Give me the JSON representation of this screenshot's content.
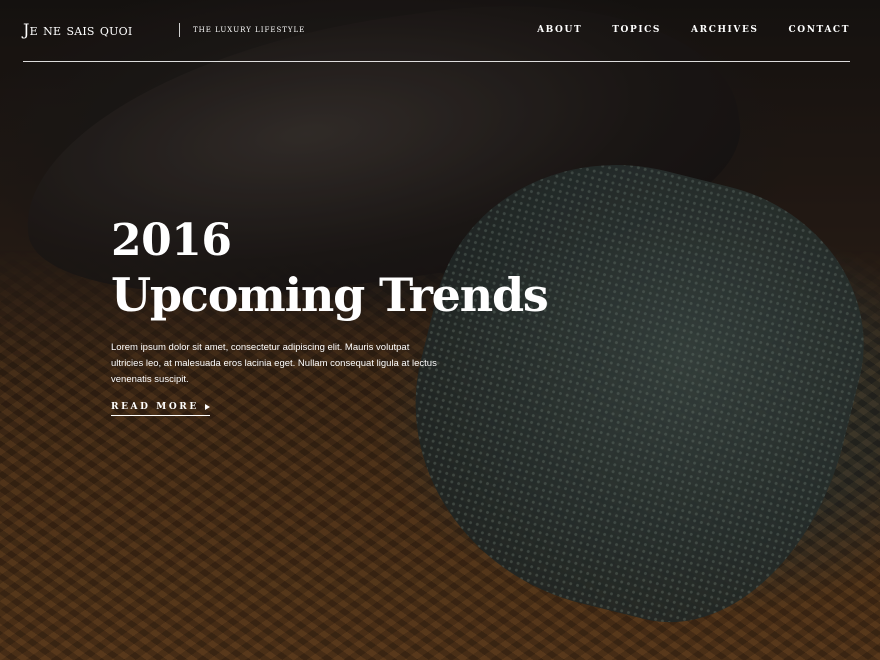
{
  "brand": {
    "logo": "Je ne sais quoi",
    "tagline": "THE LUXURY LIFESTYLE"
  },
  "nav": {
    "items": [
      {
        "label": "ABOUT"
      },
      {
        "label": "TOPICS"
      },
      {
        "label": "ARCHIVES"
      },
      {
        "label": "CONTACT"
      }
    ]
  },
  "hero": {
    "year": "2016",
    "title": "Upcoming Trends",
    "body": "Lorem ipsum dolor sit amet, consectetur adipiscing elit. Mauris volutpat ultricies leo, at malesuada eros lacinia eget. Nullam consequat ligula at lectus venenatis suscipit.",
    "cta_label": "READ MORE",
    "cta_icon": "arrow-right-icon"
  },
  "colors": {
    "text": "#ffffff",
    "background_dark": "#1b1410",
    "wood": "#5a3a1c",
    "tie": "#2b3634"
  }
}
